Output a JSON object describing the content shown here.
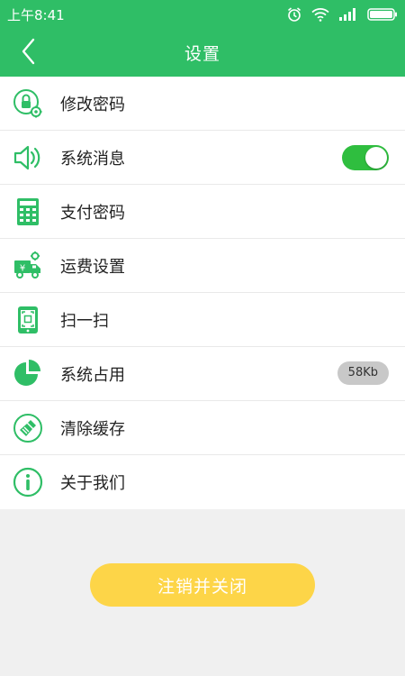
{
  "status_bar": {
    "time": "上午8:41"
  },
  "header": {
    "title": "设置",
    "back_icon": "chevron-left-icon"
  },
  "settings": {
    "items": [
      {
        "label": "修改密码",
        "icon": "lock-gear-icon"
      },
      {
        "label": "系统消息",
        "icon": "speaker-icon",
        "toggle_on": true
      },
      {
        "label": "支付密码",
        "icon": "keypad-icon"
      },
      {
        "label": "运费设置",
        "icon": "delivery-truck-icon"
      },
      {
        "label": "扫一扫",
        "icon": "scan-phone-icon"
      },
      {
        "label": "系统占用",
        "icon": "pie-chart-icon",
        "badge": "58Kb"
      },
      {
        "label": "清除缓存",
        "icon": "broom-icon"
      },
      {
        "label": "关于我们",
        "icon": "info-icon"
      }
    ]
  },
  "logout": {
    "label": "注销并关闭"
  },
  "colors": {
    "brand": "#2fbe66",
    "button": "#fdd548",
    "toggle": "#2fbe3f"
  }
}
